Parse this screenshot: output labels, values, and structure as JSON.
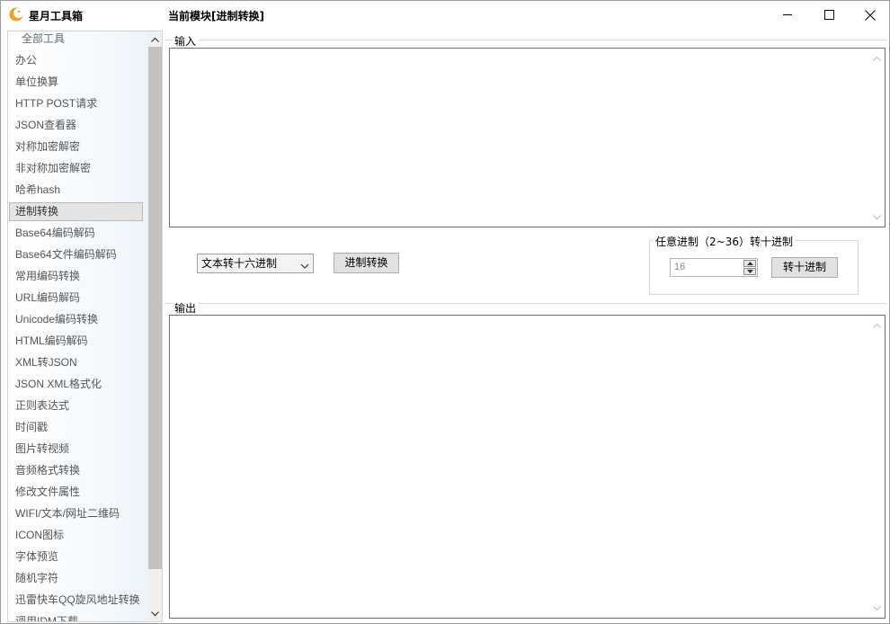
{
  "titlebar": {
    "app_title": "星月工具箱",
    "module_title": "当前模块[进制转换]"
  },
  "sidebar": {
    "items": [
      {
        "label": "全部工具",
        "kind": "header"
      },
      {
        "label": "办公"
      },
      {
        "label": "单位换算"
      },
      {
        "label": "HTTP POST请求"
      },
      {
        "label": "JSON查看器"
      },
      {
        "label": "对称加密解密"
      },
      {
        "label": "非对称加密解密"
      },
      {
        "label": "哈希hash"
      },
      {
        "label": "进制转换",
        "selected": true
      },
      {
        "label": "Base64编码解码"
      },
      {
        "label": "Base64文件编码解码"
      },
      {
        "label": "常用编码转换"
      },
      {
        "label": "URL编码解码"
      },
      {
        "label": "Unicode编码转换"
      },
      {
        "label": "HTML编码解码"
      },
      {
        "label": "XML转JSON"
      },
      {
        "label": "JSON XML格式化"
      },
      {
        "label": "正则表达式"
      },
      {
        "label": "时间戳"
      },
      {
        "label": "图片转视频"
      },
      {
        "label": "音频格式转换"
      },
      {
        "label": "修改文件属性"
      },
      {
        "label": "WIFI/文本/网址二维码"
      },
      {
        "label": "ICON图标"
      },
      {
        "label": "字体预览"
      },
      {
        "label": "随机字符"
      },
      {
        "label": "迅雷快车QQ旋风地址转换"
      },
      {
        "label": "调用IDM下载"
      }
    ]
  },
  "input_group": {
    "label": "输入",
    "value": ""
  },
  "controls": {
    "conversion_select": "文本转十六进制",
    "convert_button": "进制转换"
  },
  "radix_group": {
    "label": "任意进制（2~36）转十进制",
    "radix_value": "16",
    "to_decimal_button": "转十进制"
  },
  "output_group": {
    "label": "输出",
    "value": ""
  }
}
